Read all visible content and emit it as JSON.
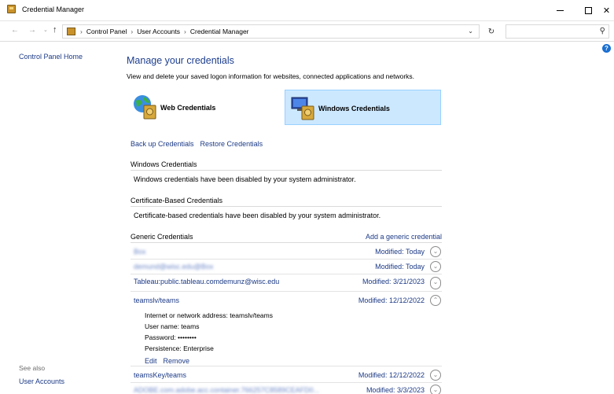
{
  "window": {
    "title": "Credential Manager"
  },
  "address": {
    "crumbs": [
      "Control Panel",
      "User Accounts",
      "Credential Manager"
    ]
  },
  "search": {
    "placeholder": ""
  },
  "leftnav": {
    "home": "Control Panel Home",
    "see_also": "See also",
    "user_accounts": "User Accounts"
  },
  "main": {
    "title": "Manage your credentials",
    "subtitle": "View and delete your saved logon information for websites, connected applications and networks.",
    "web_tab": "Web Credentials",
    "windows_tab": "Windows Credentials",
    "backup_link": "Back up Credentials",
    "restore_link": "Restore Credentials"
  },
  "windows_creds": {
    "heading": "Windows Credentials",
    "note": "Windows credentials have been disabled by your system administrator."
  },
  "cert_creds": {
    "heading": "Certificate-Based Credentials",
    "note": "Certificate-based credentials have been disabled by your system administrator."
  },
  "generic": {
    "heading": "Generic Credentials",
    "add_link": "Add a generic credential",
    "rows": [
      {
        "name": "Box",
        "modified": "Modified:  Today",
        "expanded": false,
        "blurred": true
      },
      {
        "name": "demund@wisc.edu@Box",
        "modified": "Modified:  Today",
        "expanded": false,
        "blurred": true
      },
      {
        "name": "Tableau:public.tableau.comdemunz@wisc.edu",
        "modified": "Modified:  3/21/2023",
        "expanded": false,
        "blurred": false
      },
      {
        "name": "teamslv/teams",
        "modified": "Modified:  12/12/2022",
        "expanded": true,
        "blurred": false
      },
      {
        "name": "teamsKey/teams",
        "modified": "Modified:  12/12/2022",
        "expanded": false,
        "blurred": false
      },
      {
        "name": "ADOBE.com.adobe.acc.container.766257C8589CEAFD0...",
        "modified": "Modified:  3/3/2023",
        "expanded": false,
        "blurred": true
      }
    ],
    "detail": {
      "address": "Internet or network address:  teamslv/teams",
      "username": "User name:  teams",
      "password": "Password:  ••••••••",
      "persistence": "Persistence:  Enterprise",
      "edit": "Edit",
      "remove": "Remove"
    }
  }
}
